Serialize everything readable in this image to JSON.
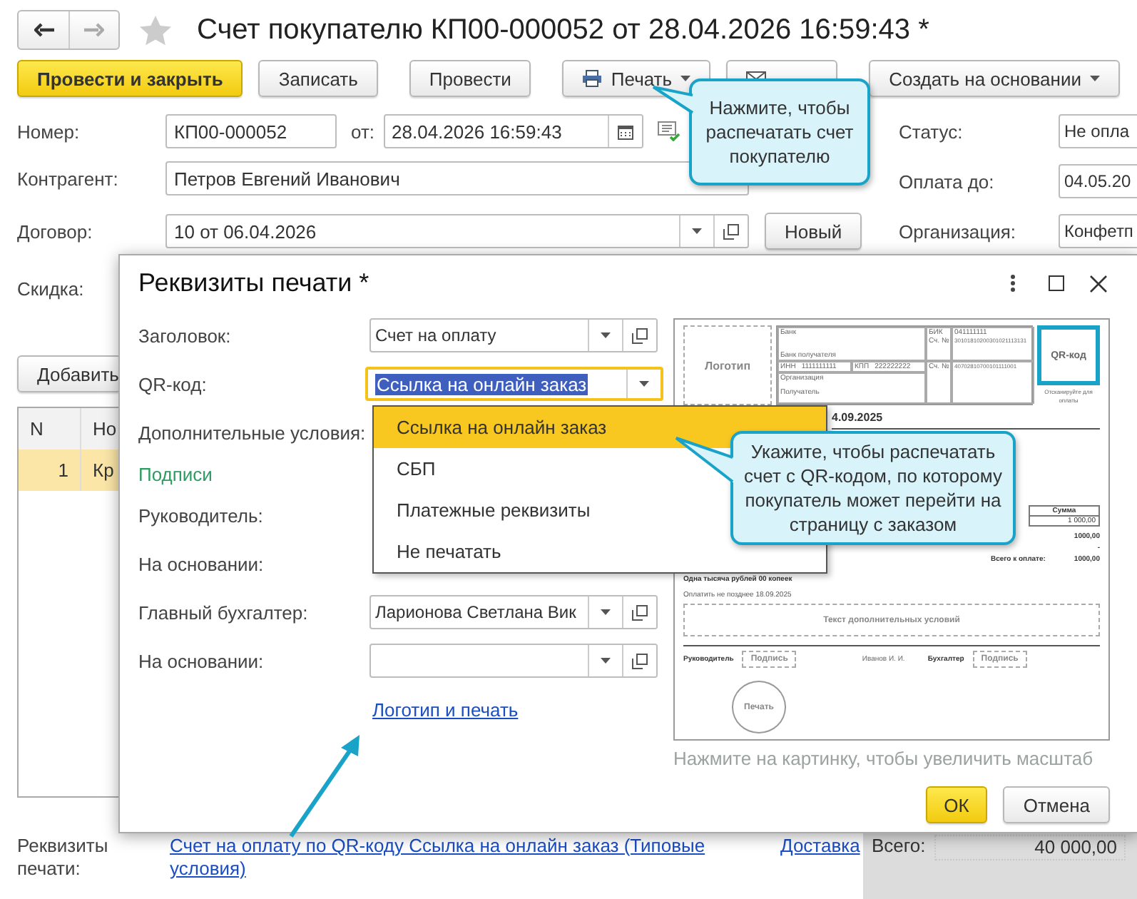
{
  "window": {
    "title": "Счет покупателю КП00-000052 от 28.04.2026 16:59:43 *",
    "favorite": false
  },
  "toolbar": [
    {
      "label": "Провести и закрыть",
      "kind": "primary"
    },
    {
      "label": "Записать",
      "kind": "plain"
    },
    {
      "label": "Провести",
      "kind": "plain"
    },
    {
      "label": "Печать",
      "kind": "print"
    },
    {
      "kind": "send"
    },
    {
      "label": "Создать на основании",
      "kind": "menu"
    }
  ],
  "number": {
    "label": "Номер:",
    "value": "КП00-000052"
  },
  "date": {
    "label": "от:",
    "value": "28.04.2026 16:59:43"
  },
  "counterparty": {
    "label": "Контрагент:",
    "value": "Петров Евгений Иванович"
  },
  "contract": {
    "label": "Договор:",
    "value": "10 от 06.04.2026",
    "button": "Новый"
  },
  "discount": {
    "label": "Скидка:"
  },
  "status": {
    "label": "Статус:",
    "value": "Не опла"
  },
  "pay_by": {
    "label": "Оплата до:",
    "value": "04.05.20"
  },
  "organization": {
    "label": "Организация:",
    "value": "Конфетп"
  },
  "add_button": "Добавить",
  "table": {
    "columns": [
      "N",
      "Но"
    ],
    "rows": [
      {
        "cells": [
          "1",
          "Кр"
        ],
        "selected": true
      }
    ]
  },
  "footer": {
    "label": "Реквизиты печати:",
    "link": "Счет на оплату по QR-коду Ссылка на онлайн заказ (Типовые условия)",
    "delivery": "Доставка",
    "total_label": "Всего:",
    "total": "40 000,00"
  },
  "dialog": {
    "title": "Реквизиты печати *",
    "rows": [
      {
        "label": "Заголовок:",
        "value": "Счет на оплату",
        "kind": "select"
      },
      {
        "label": "QR-код:",
        "value": "Ссылка на онлайн заказ",
        "kind": "focused"
      },
      {
        "label": "Дополнительные условия:",
        "kind": "label"
      },
      {
        "label": "Подписи",
        "kind": "section"
      },
      {
        "label": "Руководитель:",
        "kind": "label"
      },
      {
        "label": "На основании:",
        "kind": "label"
      },
      {
        "label": "Главный бухгалтер:",
        "value": "Ларионова Светлана Вик",
        "kind": "select"
      },
      {
        "label": "На основании:",
        "kind": "select"
      },
      {
        "label": "Логотип и печать",
        "kind": "link"
      }
    ],
    "dropdown": [
      {
        "label": "Ссылка на онлайн заказ",
        "selected": true
      },
      {
        "label": "СБП",
        "selected": false
      },
      {
        "label": "Платежные реквизиты",
        "selected": false
      },
      {
        "label": "Не печатать",
        "selected": false
      }
    ],
    "preview": {
      "logo": "Логотип",
      "bank": "Банк",
      "bank_recipient": "Банк получателя",
      "bik": "БИК",
      "bik_value": "041111111",
      "account_label": "Сч. №",
      "corr_account": "30101810200301021113131",
      "inn": "ИНН",
      "inn_value": "1111111111",
      "kpp": "КПП",
      "kpp_value": "222222222",
      "account_label_2": "Сч. №",
      "account": "40702810700101111001",
      "organization": "Организация",
      "recipient": "Получатель",
      "qr": "QR-код",
      "qr_caption": "Отсканируйте для оплаты",
      "date": "4.09.2025",
      "sum_header": "Сумма",
      "sum_value": "1 000,00",
      "subtotal": "1000,00",
      "vat": "-",
      "total_label": "Всего к оплате:",
      "total": "1000,00",
      "amount_words": "Одна тысяча рублей 00 копеек",
      "pay_before": "Оплатить не позднее 18.09.2025",
      "conditions": "Текст дополнительных условий",
      "director": "Руководитель",
      "signature": "Подпись",
      "director_name": "Иванов И. И.",
      "accountant": "Бухгалтер",
      "signature_2": "Подпись",
      "stamp": "Печать"
    },
    "caption": "Нажмите на картинку, чтобы увеличить масштаб",
    "buttons": [
      {
        "label": "ОК",
        "kind": "primary"
      },
      {
        "label": "Отмена",
        "kind": "plain"
      }
    ]
  },
  "callouts": [
    {
      "text": "Нажмите, чтобы распечатать счет покупателю"
    },
    {
      "text": "Укажите, чтобы распечатать счет с QR-кодом, по которому покупатель может перейти на страницу с заказом"
    }
  ]
}
